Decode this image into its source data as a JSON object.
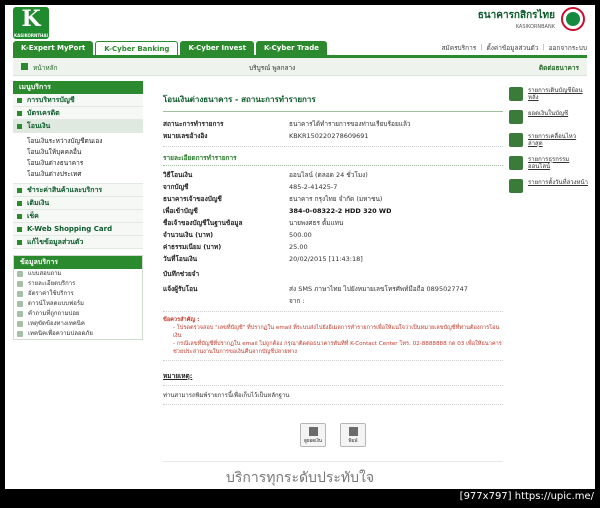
{
  "header": {
    "logo_text": "K",
    "logo_sub": "KASIKORNTHAI",
    "bank_name_th": "ธนาคารกสิกรไทย",
    "bank_name_en": "KASIKORNBANK"
  },
  "tabs": [
    "K-Expert MyPort",
    "K-Cyber Banking",
    "K-Cyber Invest",
    "K-Cyber Trade"
  ],
  "toplinks": [
    "สมัครบริการ",
    "ตั้งค่าข้อมูลส่วนตัว",
    "ออกจากระบบ"
  ],
  "subbar": {
    "home": "หน้าหลัก",
    "welcome": "บริบูรณ์ พูลกลาง",
    "contact": "ติดต่อธนาคาร"
  },
  "sidebar": {
    "menu_title": "เมนูบริการ",
    "items": [
      {
        "label": "การบริหารบัญชี"
      },
      {
        "label": "บัตรเครดิต"
      },
      {
        "label": "โอนเงิน"
      }
    ],
    "transfer_sub": [
      "โอนเงินระหว่างบัญชีตนเอง",
      "โอนเงินให้บุคคลอื่น",
      "โอนเงินต่างธนาคาร",
      "โอนเงินต่างประเทศ"
    ],
    "items2": [
      {
        "label": "ชำระค่าสินค้าและบริการ"
      },
      {
        "label": "เติมเงิน"
      },
      {
        "label": "เช็ค"
      },
      {
        "label": "K-Web Shopping Card"
      },
      {
        "label": "แก้ไขข้อมูลส่วนตัว"
      }
    ],
    "info_title": "ข้อมูลบริการ",
    "info_items": [
      "แบบสอบถาม",
      "รายละเอียดบริการ",
      "อัตราค่าใช้บริการ",
      "ดาวน์โหลดแบบฟอร์ม",
      "คำถามที่ถูกถามบ่อย",
      "เหตุขัดข้องทางเทคนิค",
      "เทคนิคเพื่อความปลอดภัย"
    ]
  },
  "main": {
    "title": "โอนเงินต่างธนาคาร - สถานะการทำรายการ",
    "status_label": "สถานะการทำรายการ",
    "status_value": "ธนาคารได้ทำรายการของท่านเรียบร้อยแล้ว",
    "ref_label": "หมายเลขอ้างอิง",
    "ref_value": "KBKR150220278609691",
    "detail_title": "รายละเอียดการทำรายการ",
    "rows": [
      {
        "label": "วิธีโอนเงิน",
        "value": "ออนไลน์ (ตลอด 24 ชั่วโมง)"
      },
      {
        "label": "จากบัญชี",
        "value": "485-2-41425-7"
      },
      {
        "label": "ธนาคารเจ้าของบัญชี",
        "value": "ธนาคาร กรุงไทย จำกัด (มหาชน)"
      },
      {
        "label": "เพื่อเข้าบัญชี",
        "value": "384-0-08322-2 HDD 320 WD"
      },
      {
        "label": "ชื่อเจ้าของบัญชีในฐานข้อมูล",
        "value": "นายพงศธร ตั้มแทน"
      },
      {
        "label": "จำนวนเงิน (บาท)",
        "value": "500.00"
      },
      {
        "label": "ค่าธรรมเนียม (บาท)",
        "value": "25.00"
      },
      {
        "label": "วันที่โอนเงิน",
        "value": "20/02/2015 [11:43:18]"
      },
      {
        "label": "บันทึกช่วยจำ",
        "value": ""
      },
      {
        "label": "แจ้งผู้รับโอน",
        "value": "ส่ง SMS ภาษาไทย ไปยังหมายเลขโทรศัพท์มือถือ 0895027747"
      }
    ],
    "sms_extra": "จาก :",
    "note_title": "ข้อควรสำคัญ :",
    "note_1": "- โปรดตรวจสอบ \"เลขที่บัญชี\" ที่ปรากฏใน email ที่ระบบส่งไปยังอีเมลการทำรายการเพื่อให้แน่ใจว่าเป็นหมายเลขบัญชีที่ท่านต้องการโอนเงิน",
    "note_2": "- กรณีเลขที่บัญชีที่ปรากฏใน email ไม่ถูกต้อง กรุณาติดต่อธนาคารทันทีที่ K-Contact Center โทร. 02-8888888 กด 03 เพื่อให้ธนาคารช่วยประสานงานในการขอเงินคืนจากบัญชีปลายทาง",
    "remark_title": "หมายเหตุ:",
    "remark_text": "ท่านสามารถพิมพ์รายการนี้เพื่อเก็บไว้เป็นหลักฐาน",
    "btn_save": "ดูยอดเงิน",
    "btn_print": "พิมพ์"
  },
  "rail": [
    "รายการเดินบัญชีย้อนหลัง",
    "ยอดเงินในบัญชี",
    "รายการเคลื่อนไหวล่าสุด",
    "รายการธุรกรรมออนไลน์",
    "รายการตั้งวันที่ล่วงหน้า"
  ],
  "footer": {
    "slogan": "บริการทุกระดับประทับใจ"
  },
  "watermark": "[977x797] https://upic.me/"
}
